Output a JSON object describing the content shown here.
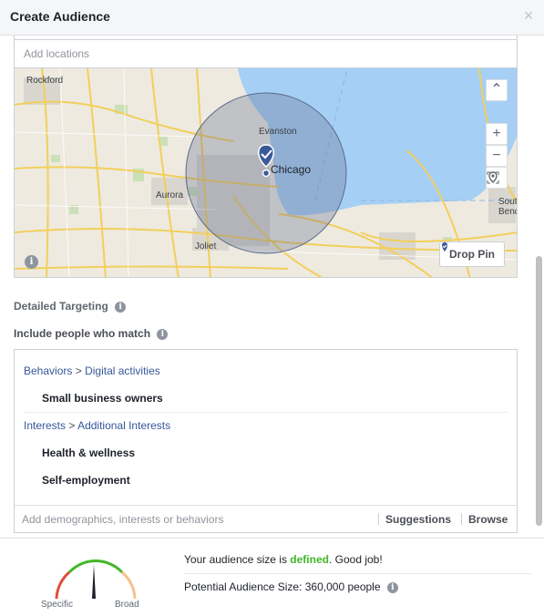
{
  "dialog": {
    "title": "Create Audience",
    "close_glyph": "×"
  },
  "locations": {
    "placeholder": "Add locations"
  },
  "map": {
    "labels": {
      "rockford": "Rockford",
      "evanston": "Evanston",
      "chicago": "Chicago",
      "aurora": "Aurora",
      "joliet": "Joliet",
      "south_bend_1": "South",
      "south_bend_2": "Bend"
    },
    "controls": {
      "collapse": "⌃",
      "zoom_in": "+",
      "zoom_out": "−"
    },
    "drop_pin_label": "Drop Pin",
    "info_glyph": "i",
    "colors": {
      "water": "#a6cff5",
      "radius_fill": "rgba(90,110,150,0.35)",
      "pin": "#3b5998",
      "road": "#f5d76e"
    }
  },
  "detailed_targeting": {
    "label": "Detailed Targeting"
  },
  "include": {
    "label": "Include people who match",
    "groups": [
      {
        "category": "Behaviors",
        "separator": ">",
        "subcategory": "Digital activities",
        "items": [
          "Small business owners"
        ]
      },
      {
        "category": "Interests",
        "separator": ">",
        "subcategory": "Additional Interests",
        "items": [
          "Health & wellness",
          "Self-employment"
        ]
      }
    ],
    "input_placeholder": "Add demographics, interests or behaviors",
    "suggestions_label": "Suggestions",
    "browse_label": "Browse"
  },
  "audience": {
    "gauge": {
      "specific_label": "Specific",
      "broad_label": "Broad",
      "needle_position": 0.5
    },
    "size_prefix": "Your audience size is ",
    "size_status": "defined",
    "size_suffix": ". Good job!",
    "potential_label": "Potential Audience Size: 360,000 people",
    "info_glyph": "i"
  }
}
